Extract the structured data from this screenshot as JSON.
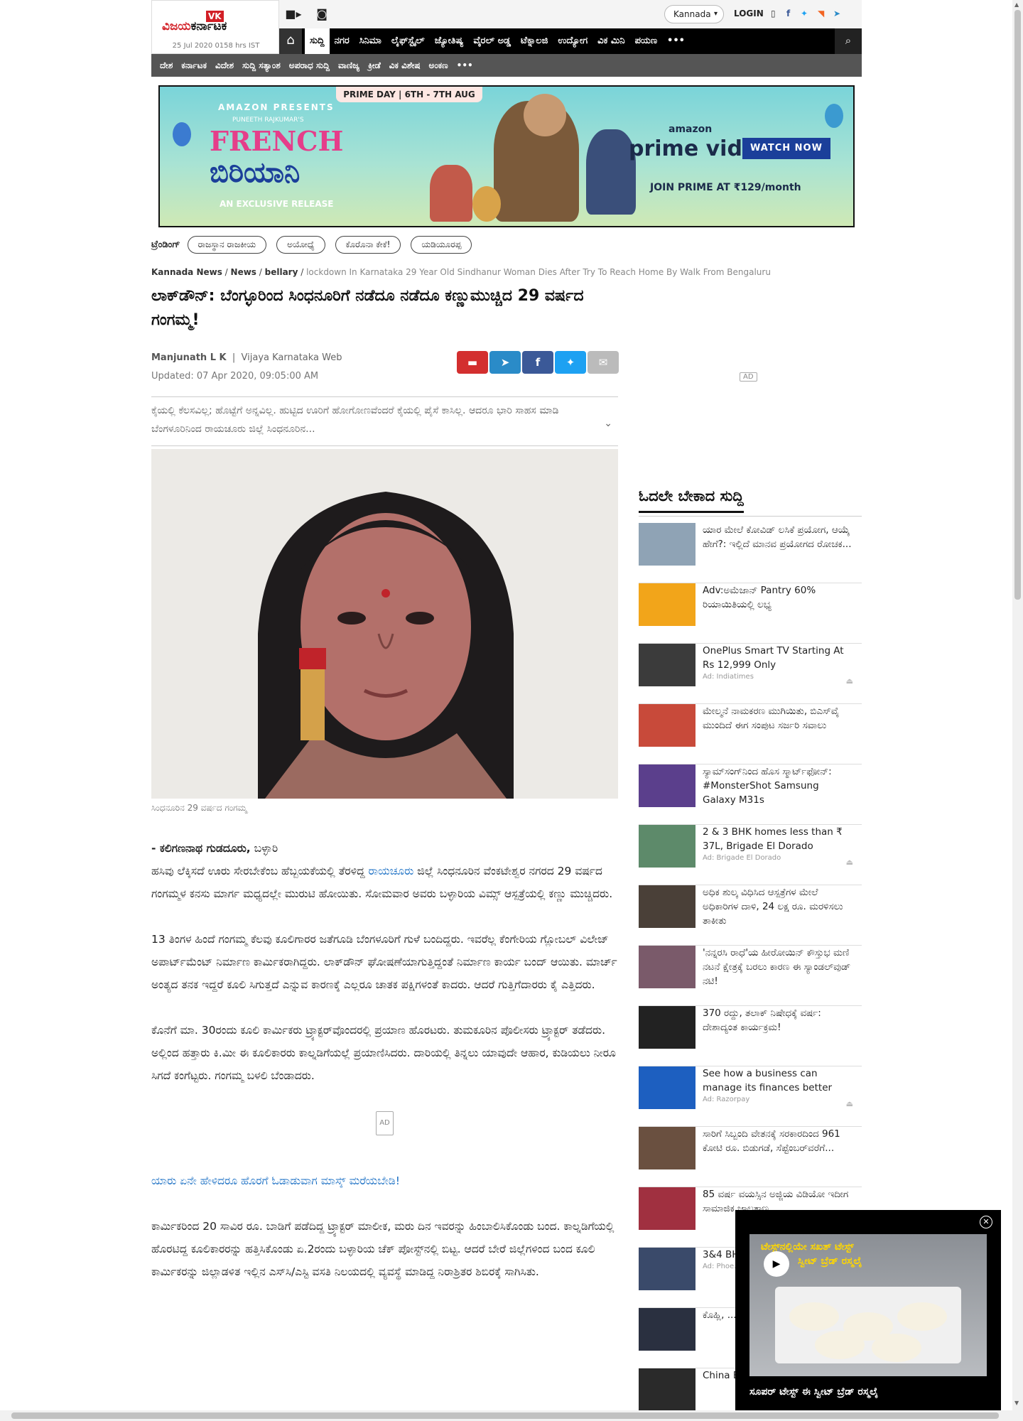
{
  "header": {
    "logo_badge": "VK",
    "logo_name_a": "ವಿಜಯ",
    "logo_name_b": "ಕರ್ನಾಟಕ",
    "date": "25 Jul 2020 0158 hrs IST",
    "language": "Kannada",
    "login": "LOGIN"
  },
  "nav_primary": [
    "ಸುದ್ದಿ",
    "ನಗರ",
    "ಸಿನಿಮಾ",
    "ಲೈಫ್‌ಸ್ಟೈಲ್",
    "ಜ್ಯೋತಿಷ್ಯ",
    "ವೈರಲ್ ಅಡ್ಡ",
    "ಟೆಕ್ನಾಲಜಿ",
    "ಉದ್ಯೋಗ",
    "ವಿಕ ಮಿನಿ",
    "ಪಯಣ",
    "•••"
  ],
  "nav_secondary": [
    "ದೇಶ",
    "ಕರ್ನಾಟಕ",
    "ವಿದೇಶ",
    "ಸುದ್ದಿ ಸತ್ಯಾಂಶ",
    "ಅಪರಾಧ ಸುದ್ದಿ",
    "ವಾಣಿಜ್ಯ",
    "ಕ್ರೀಡೆ",
    "ವಿಕ ವಿಶೇಷ",
    "ಅಂಕಣ",
    "•••"
  ],
  "banner": {
    "prime_day": "PRIME DAY | 6TH - 7TH AUG",
    "presents": "AMAZON PRESENTS",
    "producer": "PUNEETH RAJKUMAR'S",
    "movie_a": "FRENCH",
    "movie_b": "ಬಿರಿಯಾನಿ",
    "exclusive": "AN EXCLUSIVE RELEASE",
    "amazon": "amazon",
    "prime_video": "prime video",
    "watch_now": "WATCH NOW",
    "join": "JOIN PRIME AT ₹129/month"
  },
  "trending": {
    "label": "ಟ್ರೆಂಡಿಂಗ್",
    "items": [
      "ರಾಜಸ್ಥಾನ ರಾಜಕೀಯ",
      "ಅಯೋಧ್ಯೆ",
      "ಕೊರೊನಾ ಕೇಕೆ!",
      "ಯಡಿಯೂರಪ್ಪ"
    ]
  },
  "breadcrumb": {
    "items": [
      "Kannada News",
      "News",
      "bellary"
    ],
    "current": "lockdown In Karnataka 29 Year Old Sindhanur Woman Dies After Try To Reach Home By Walk From Bengaluru"
  },
  "article": {
    "title": "ಲಾಕ್‌ಡೌನ್: ಬೆಂಗ್ಳೂರಿಂದ ಸಿಂಧನೂರಿಗೆ ನಡೆದೂ ನಡೆದೂ ಕಣ್ಣುಮುಚ್ಚಿದ 29 ವರ್ಷದ ಗಂಗಮ್ಮ!",
    "author": "Manjunath L K",
    "publisher": "Vijaya Karnataka Web",
    "updated": "Updated: 07 Apr 2020, 09:05:00 AM",
    "summary": "ಕೈಯಲ್ಲಿ ಕೆಲಸವಿಲ್ಲ; ಹೊಟ್ಟೆಗೆ ಅನ್ನವಿಲ್ಲ. ಹುಟ್ಟಿದ ಊರಿಗೆ ಹೋಗೋಣವೆಂದರೆ ಕೈಯಲ್ಲಿ ಪೈಸೆ ಕಾಸಿಲ್ಲ. ಆದರೂ ಭಾರಿ ಸಾಹಸ ಮಾಡಿ ಬೆಂಗಳೂರಿನಿಂದ ರಾಯಚೂರು ಜಿಲ್ಲೆ ಸಿಂಧನೂರಿನ...",
    "caption": "ಸಿಂಧನೂರಿನ 29 ವರ್ಷದ ಗಂಗಮ್ಮ",
    "byline_name": "- ಕಲಿಗಣನಾಥ ಗುಡದೂರು,",
    "byline_place": "ಬಳ್ಳಾರಿ",
    "p1_a": "ಹಸಿವು ಲೆಕ್ಕಿಸದೆ ಊರು ಸೇರಬೇಕೆಂಬ ಹೆಬ್ಬಯಕೆಯಲ್ಲಿ ತೆರಳಿದ್ದ",
    "p1_link": "ರಾಯಚೂರು",
    "p1_b": "ಜಿಲ್ಲೆ ಸಿಂಧನೂರಿನ ವೆಂಕಟೇಶ್ವರ ನಗರದ 29 ವರ್ಷದ ಗಂಗಮ್ಮಳ ಕನಸು ಮಾರ್ಗ ಮಧ್ಯದಲ್ಲೇ ಮುರುಟಿ ಹೋಯಿತು. ಸೋಮವಾರ ಅವರು ಬಳ್ಳಾರಿಯ ವಿಮ್ಸ್‌ ಆಸ್ಪತ್ರೆಯಲ್ಲಿ ಕಣ್ಣು ಮುಚ್ಚಿದರು.",
    "p2": "13 ತಿಂಗಳ ಹಿಂದೆ ಗಂಗಮ್ಮ ಕೆಲವು ಕೂಲಿಗಾರರ ಜತೆಗೂಡಿ ಬೆಂಗಳೂರಿಗೆ ಗುಳೆ ಬಂದಿದ್ದರು. ಇವರೆಲ್ಲ ಕೆಂಗೇರಿಯ ಗ್ಲೋಬಲ್‌ ವಿಲೇಜ್‌ ಅಪಾರ್ಟ್‌ಮೆಂಟ್‌ ನಿರ್ಮಾಣ ಕಾರ್ಮಿಕರಾಗಿದ್ದರು. ಲಾಕ್‌ಡೌನ್‌ ಘೋಷಣೆಯಾಗುತ್ತಿದ್ದಂತೆ ನಿರ್ಮಾಣ ಕಾರ್ಯ ಬಂದ್‌ ಆಯಿತು. ಮಾರ್ಚ್‌ ಅಂತ್ಯದ ತನಕ ಇದ್ದರೆ ಕೂಲಿ ಸಿಗುತ್ತದೆ ಎನ್ನುವ ಕಾರಣಕ್ಕೆ ಎಲ್ಲರೂ ಚಾತಕ ಪಕ್ಷಿಗಳಂತೆ ಕಾದರು. ಆದರೆ ಗುತ್ತಿಗೆದಾರರು ಕೈ ಎತ್ತಿದರು.",
    "p3": "ಕೊನೆಗೆ ಮಾ. 30ರಂದು ಕೂಲಿ ಕಾರ್ಮಿಕರು ಟ್ರ್ಯಾಕ್ಟರ್‌ವೊಂದರಲ್ಲಿ ಪ್ರಯಾಣ ಹೊರಟರು. ತುಮಕೂರಿನ ಪೊಲೀಸರು ಟ್ರ್ಯಾಕ್ಟರ್‌ ತಡೆದರು. ಅಲ್ಲಿಂದ ಹತ್ತಾರು ಕಿ.ಮೀ ಈ ಕೂಲಿಕಾರರು ಕಾಲ್ನಡಿಗೆಯಲ್ಲೆ ಪ್ರಯಾಣಿಸಿದರು. ದಾರಿಯಲ್ಲಿ ತಿನ್ನಲು ಯಾವುದೇ ಆಹಾರ, ಕುಡಿಯಲು ನೀರೂ ಸಿಗದೆ ಕಂಗೆಟ್ಟರು. ಗಂಗಮ್ಮ ಬಳಲಿ ಬೆಂಡಾದರು.",
    "ad_label": "AD",
    "related_link": "ಯಾರು ಏನೇ ಹೇಳಿದರೂ ಹೊರಗೆ ಓಡಾಡುವಾಗ ಮಾಸ್ಕ್ ಮರೆಯಬೇಡಿ!",
    "p4": "ಕಾರ್ಮಿಕರಿಂದ 20 ಸಾವಿರ ರೂ. ಬಾಡಿಗೆ ಪಡೆದಿದ್ದ ಟ್ರ್ಯಾಕ್ಟರ್‌ ಮಾಲೀಕ, ಮರು ದಿನ ಇವರನ್ನು ಹಿಂಬಾಲಿಸಿಕೊಂಡು ಬಂದ. ಕಾಲ್ನಡಿಗೆಯಲ್ಲಿ ಹೊರಟಿದ್ದ ಕೂಲಿಕಾರರನ್ನು ಹತ್ತಿಸಿಕೊಂಡು ಏ.2ರಂದು ಬಳ್ಳಾರಿಯ ಚೆಕ್‌ ಪೋಸ್ಟ್‌ನಲ್ಲಿ ಬಿಟ್ಟ. ಆದರೆ ಬೇರೆ ಜಿಲ್ಲೆಗಳಿಂದ ಬಂದ ಕೂಲಿ ಕಾರ್ಮಿಕರನ್ನು ಜಿಲ್ಲಾಡಳಿತ ಇಲ್ಲಿನ ಎಸ್‌ಸಿ/ಎಸ್ಟಿ ವಸತಿ ನಿಲಯದಲ್ಲಿ ವ್ಯವಸ್ಥೆ ಮಾಡಿದ್ದ ನಿರಾಶ್ರಿತರ ಶಿಬಿರಕ್ಕೆ ಸಾಗಿಸಿತು."
  },
  "sidebar": {
    "ad_label": "AD",
    "heading": "ಓದಲೇ ಬೇಕಾದ ಸುದ್ದಿ",
    "items": [
      {
        "text": "ಯಾರ ಮೇಲೆ ಕೋವಿಡ್ ಲಸಿಕೆ ಪ್ರಯೋಗ, ಆಯ್ಕೆ ಹೇಗೆ?: ಇಲ್ಲಿದೆ ಮಾನವ ಪ್ರಯೋಗದ ರೋಚಕ...",
        "ad": "",
        "color": "#8fa3b5"
      },
      {
        "text": "Adv:ಅಮೆಜಾನ್ Pantry 60% ರಿಯಾಯಿತಿಯಲ್ಲಿ ಲಭ್ಯ",
        "ad": "",
        "color": "#f2a51a"
      },
      {
        "text": "OnePlus Smart TV Starting At Rs 12,999 Only",
        "ad": "Ad: Indiatimes",
        "color": "#3b3b3b"
      },
      {
        "text": "ಮೇಲ್ಮನೆ ನಾಮಕರಣ ಮುಗಿಯಿತು, ಬಿಎಸ್‌ವೈ ಮುಂದಿದೆ ಈಗ ಸಂಪುಟ ಸರ್ಜರಿ ಸವಾಲು",
        "ad": "",
        "color": "#c84a3a"
      },
      {
        "text": "ಸ್ಯಾಮ್‌ಸಂಗ್‌ನಿಂದ ಹೊಸ ಸ್ಮಾರ್ಟ್‌ಫೋನ್: #MonsterShot Samsung Galaxy M31s",
        "ad": "",
        "color": "#5b3f8c"
      },
      {
        "text": "2 & 3 BHK homes less than ₹ 37L, Brigade El Dorado",
        "ad": "Ad: Brigade El Dorado",
        "color": "#5d8a6a"
      },
      {
        "text": "ಅಧಿಕ ಶುಲ್ಕ ವಿಧಿಸಿದ ಆಸ್ಪತ್ರೆಗಳ ಮೇಲೆ ಅಧಿಕಾರಿಗಳ ದಾಳಿ, 24 ಲಕ್ಷ ರೂ. ಮರಳಿಸಲು ತಾಕೀತು",
        "ad": "",
        "color": "#4a4038"
      },
      {
        "text": "'ನನ್ನರಸಿ ರಾಧೆ'ಯ ಹೀರೋಯಿನ್ ಕೌಸ್ತುಭ ಮಣಿ ನಟನೆ ಕ್ಷೇತ್ರಕ್ಕೆ ಬರಲು ಕಾರಣ ಈ ಸ್ಯಾಂಡಲ್‌ವುಡ್ ನಟಿ!",
        "ad": "",
        "color": "#7a5a6a"
      },
      {
        "text": "370 ರದ್ದು, ತಲಾಕ್ ನಿಷೇಧಕ್ಕೆ ವರ್ಷ: ದೇಶಾದ್ಯಂತ ಕಾರ್ಯಕ್ರಮ!",
        "ad": "",
        "color": "#222222"
      },
      {
        "text": "See how a business can manage its finances better",
        "ad": "Ad: Razorpay",
        "color": "#1d5fc0"
      },
      {
        "text": "ಸಾರಿಗೆ ಸಿಬ್ಬಂದಿ ವೇತನಕ್ಕೆ ಸರಕಾರದಿಂದ 961 ಕೋಟಿ ರೂ. ಬಿಡುಗಡೆ, ಸೆಪ್ಟೆಂಬರ್‌ವರೆಗೆ...",
        "ad": "",
        "color": "#6a5040"
      },
      {
        "text": "85 ವರ್ಷ ವಯಸ್ಸಿನ ಅಜ್ಜಿಯ ವಿಡಿಯೋ ಇದೀಗ ಸಾಮಾಜಿಕ ಜಾಲತಾಣ...",
        "ad": "",
        "color": "#a03040"
      },
      {
        "text": "3&4 BHK starting...",
        "ad": "Ad: Phoe...",
        "color": "#3a4a6a"
      },
      {
        "text": "ಕೊಹ್ಲಿ, ... ಬೆಸ್ಟ್ ... ಮ್ಯಾಥ್ಯೂ...",
        "ad": "",
        "color": "#2a3040"
      },
      {
        "text": "China B... ಬೇಡವೆ... ಖರೀದಿ...",
        "ad": "",
        "color": "#2a2a2a"
      }
    ]
  },
  "video_popup": {
    "title_a": "ಟೇಸ್ಟ್‌ನಲ್ಲಿಯೇ ಸಖತ್ ಟೇಸ್ಟ್",
    "title_b": "ಸ್ವೀಟ್ ಬ್ರೆಡ್ ರಸ್ಮಲೈ",
    "caption": "ಸೂಪರ್ ಟೇಸ್ಟ್ ಈ ಸ್ವೀಟ್ ಬ್ರೆಡ್ ರಸ್ಮಲೈ"
  },
  "colors": {
    "brand_red": "#d21f26",
    "link_blue": "#1a6fc4",
    "share_comment": "#d32f2f",
    "share_telegram": "#2a8bc8",
    "share_facebook": "#3b5998",
    "share_twitter": "#1da1f2",
    "share_mail": "#bbbbbb"
  }
}
